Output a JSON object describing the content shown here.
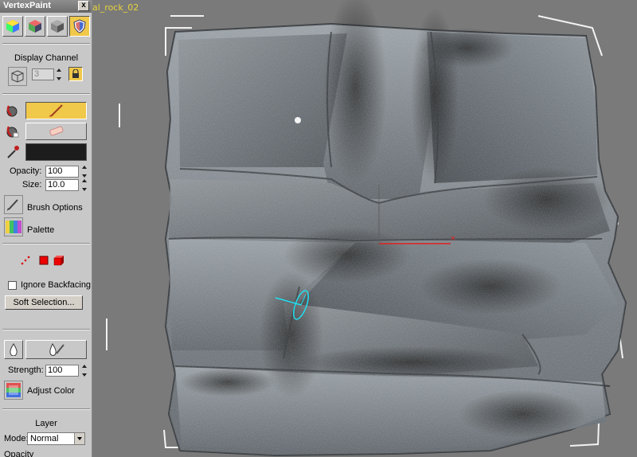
{
  "panel": {
    "title": "VertexPaint",
    "close": "x",
    "display_channel": {
      "label": "Display Channel",
      "value": "3"
    },
    "opacity": {
      "label": "Opacity:",
      "value": "100"
    },
    "size": {
      "label": "Size:",
      "value": "10.0"
    },
    "brush_options": "Brush Options",
    "palette": "Palette",
    "ignore_backfacing": "Ignore Backfacing",
    "soft_selection": "Soft Selection...",
    "strength": {
      "label": "Strength:",
      "value": "100"
    },
    "adjust_color": "Adjust Color",
    "layer": {
      "header": "Layer",
      "mode_label": "Mode:",
      "mode_value": "Normal",
      "opacity_label": "Opacity"
    },
    "paint_color": "#1c1c1c",
    "accent": "#f0c84a"
  },
  "viewport": {
    "object_name": "al_rock_02"
  }
}
